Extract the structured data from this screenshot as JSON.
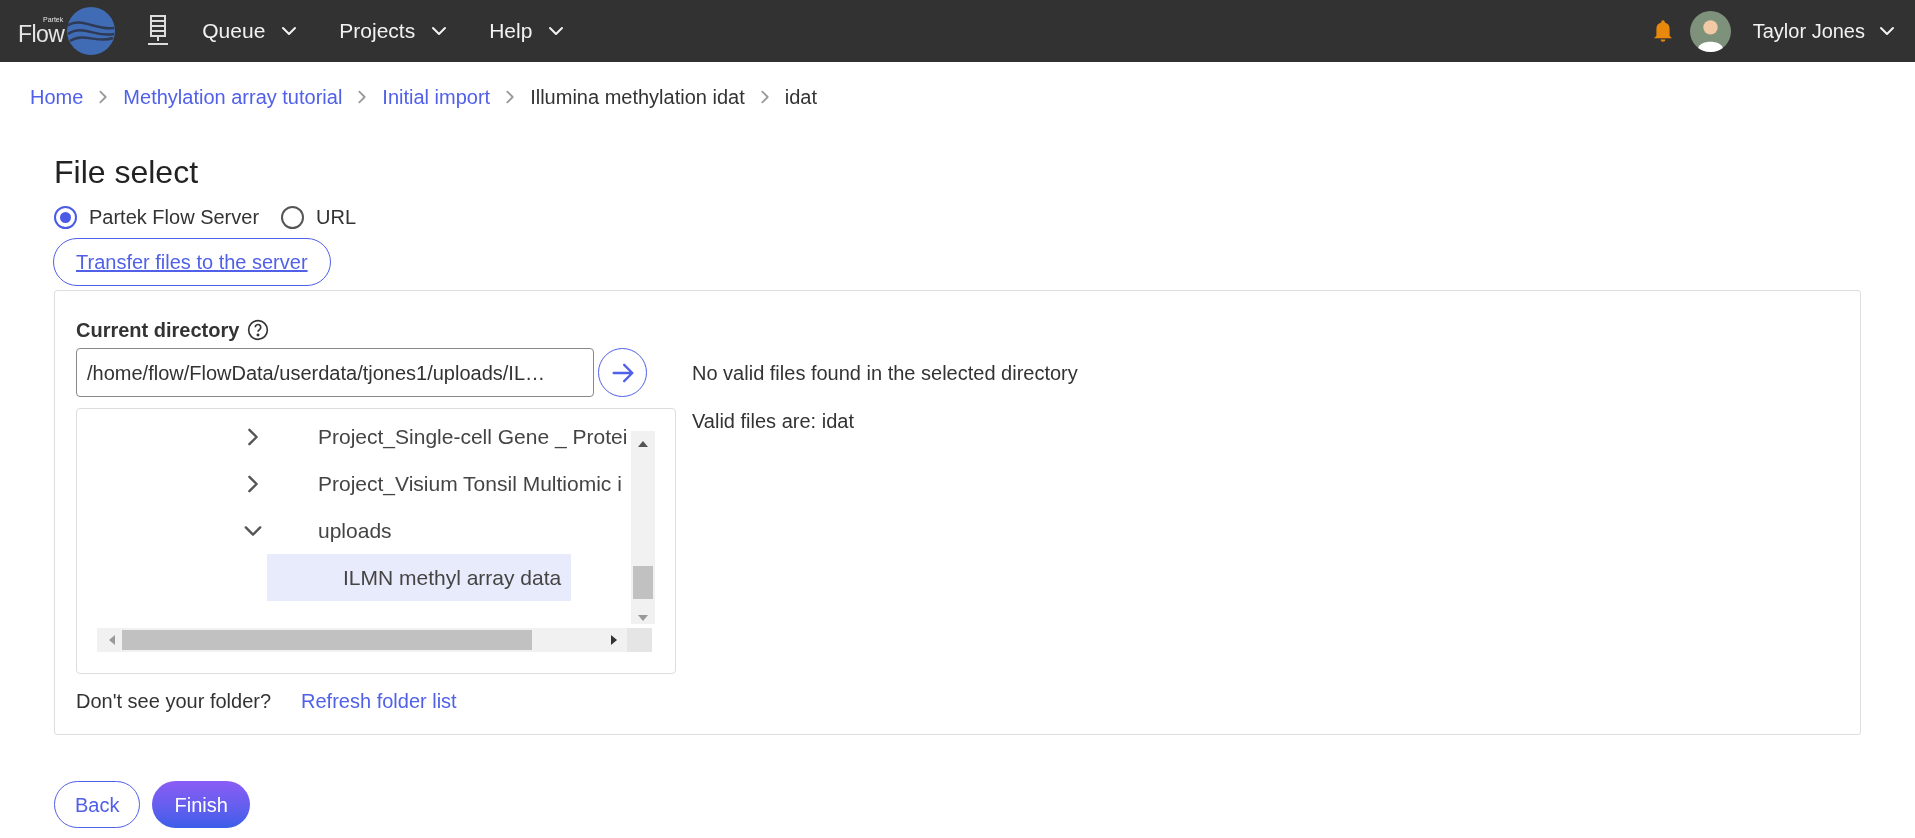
{
  "header": {
    "logo": {
      "small": "Partek",
      "large": "Flow"
    },
    "menus": [
      {
        "label": "Queue"
      },
      {
        "label": "Projects"
      },
      {
        "label": "Help"
      }
    ],
    "user": {
      "name": "Taylor Jones"
    }
  },
  "breadcrumb": [
    {
      "label": "Home",
      "link": true
    },
    {
      "label": "Methylation array tutorial",
      "link": true
    },
    {
      "label": "Initial import",
      "link": true
    },
    {
      "label": "Illumina methylation idat",
      "link": false
    },
    {
      "label": "idat",
      "link": false
    }
  ],
  "title": "File select",
  "sources": [
    {
      "label": "Partek Flow Server",
      "selected": true
    },
    {
      "label": "URL",
      "selected": false
    }
  ],
  "transfer_link": "Transfer files to the server",
  "directory": {
    "label": "Current directory",
    "value": "/home/flow/FlowData/userdata/tjones1/uploads/IL…"
  },
  "tree": [
    {
      "label": "Project_Single-cell Gene _ Protei",
      "expanded": false,
      "selected": false
    },
    {
      "label": "Project_Visium Tonsil Multiomic i",
      "expanded": false,
      "selected": false
    },
    {
      "label": "uploads",
      "expanded": true,
      "selected": false,
      "children": [
        {
          "label": "ILMN methyl array data",
          "selected": true
        }
      ]
    }
  ],
  "messages": [
    "No valid files found in the selected directory",
    "Valid files are: idat"
  ],
  "folder_hint": "Don't see your folder?",
  "refresh_link": "Refresh folder list",
  "buttons": [
    {
      "label": "Back",
      "kind": "secondary"
    },
    {
      "label": "Finish",
      "kind": "primary"
    }
  ]
}
